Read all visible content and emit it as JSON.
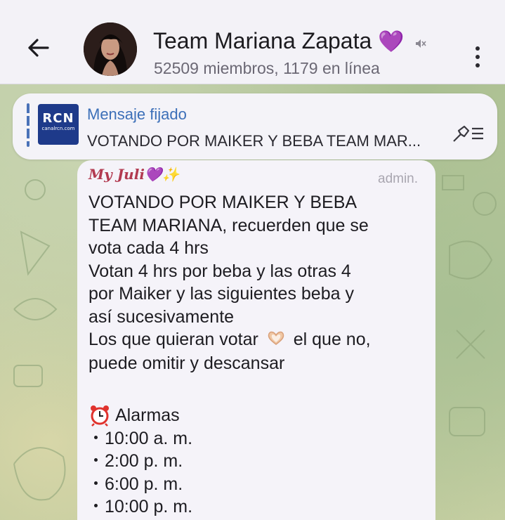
{
  "header": {
    "back_icon": "arrow-left-icon",
    "channel_name": "Team Mariana Zapata",
    "name_emoji": "💜",
    "mute_icon": "muted-speaker-icon",
    "status": "52509 miembros, 1179 en línea",
    "menu_icon": "kebab-menu-icon"
  },
  "pinned": {
    "label": "Mensaje fijado",
    "text": "VOTANDO POR MAIKER Y BEBA TEAM MAR...",
    "thumb_logo": "RCN",
    "thumb_small": "canalrcn.com",
    "icon": "pinned-list-icon"
  },
  "message": {
    "sender": "My Juli",
    "sender_emojis": "💜✨",
    "badge": "admin.",
    "lines": [
      "VOTANDO POR MAIKER Y BEBA",
      "TEAM MARIANA, recuerden que se",
      "vota cada 4 hrs",
      "Votan 4 hrs por beba y las otras 4",
      "por Maiker y las siguientes beba y",
      "así sucesivamente",
      "Los que quieran votar",
      "el que no,",
      "puede omitir y descansar"
    ],
    "alarm_title": "Alarmas",
    "alarm_icon": "alarm-clock-icon",
    "times": [
      "10:00 a. m.",
      "2:00 p. m.",
      "6:00 p. m.",
      "10:00 p. m."
    ]
  },
  "colors": {
    "header_bg": "#f3f2f7",
    "accent_blue": "#3c6fb8",
    "heart": "#d63cc8",
    "sender": "#b23a50"
  }
}
